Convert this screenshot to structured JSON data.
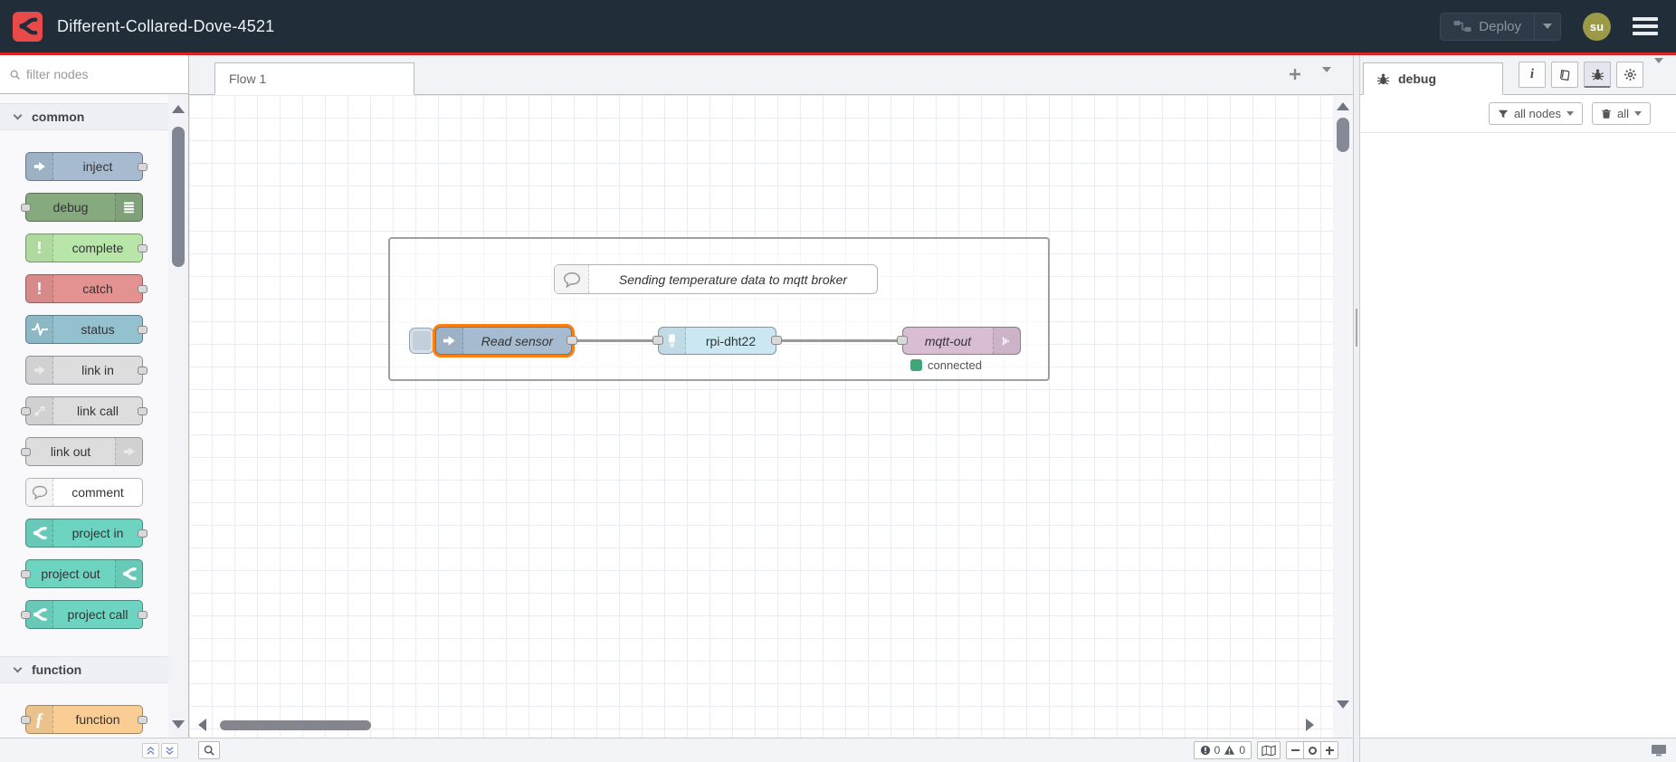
{
  "header": {
    "title": "Different-Collared-Dove-4521",
    "deploy_label": "Deploy",
    "user_initials": "su"
  },
  "palette": {
    "filter_placeholder": "filter nodes",
    "categories": [
      {
        "label": "common",
        "items": [
          {
            "label": "inject"
          },
          {
            "label": "debug"
          },
          {
            "label": "complete"
          },
          {
            "label": "catch"
          },
          {
            "label": "status"
          },
          {
            "label": "link in"
          },
          {
            "label": "link call"
          },
          {
            "label": "link out"
          },
          {
            "label": "comment"
          },
          {
            "label": "project in"
          },
          {
            "label": "project out"
          },
          {
            "label": "project call"
          }
        ]
      },
      {
        "label": "function",
        "items": [
          {
            "label": "function"
          }
        ]
      }
    ]
  },
  "workspace": {
    "tab_label": "Flow 1",
    "comment_text": "Sending temperature data to mqtt broker",
    "nodes": [
      {
        "label": "Read sensor"
      },
      {
        "label": "rpi-dht22"
      },
      {
        "label": "mqtt-out"
      }
    ],
    "mqtt_status": "connected",
    "footer": {
      "error_count": "0",
      "warning_count": "0"
    }
  },
  "sidebar": {
    "tab_label": "debug",
    "filter_button": "all nodes",
    "clear_button": "all"
  },
  "colors": {
    "header_bg": "#212d39",
    "accent_red": "#dd2222",
    "logo_red": "#e84a4a",
    "selection_orange": "#ff7f0e",
    "status_green": "#40a578",
    "node_inject": "#a6bbcf",
    "node_debug": "#87a980",
    "node_complete": "#b8e6a9",
    "node_catch": "#e49191",
    "node_status": "#94c1d0",
    "node_link": "#dddddd",
    "node_comment": "#ffffff",
    "node_project": "#6ed4c2",
    "node_function": "#f9cd94",
    "node_rpi_dht22": "#cbe7f2",
    "node_mqtt": "#d8bdd3"
  }
}
